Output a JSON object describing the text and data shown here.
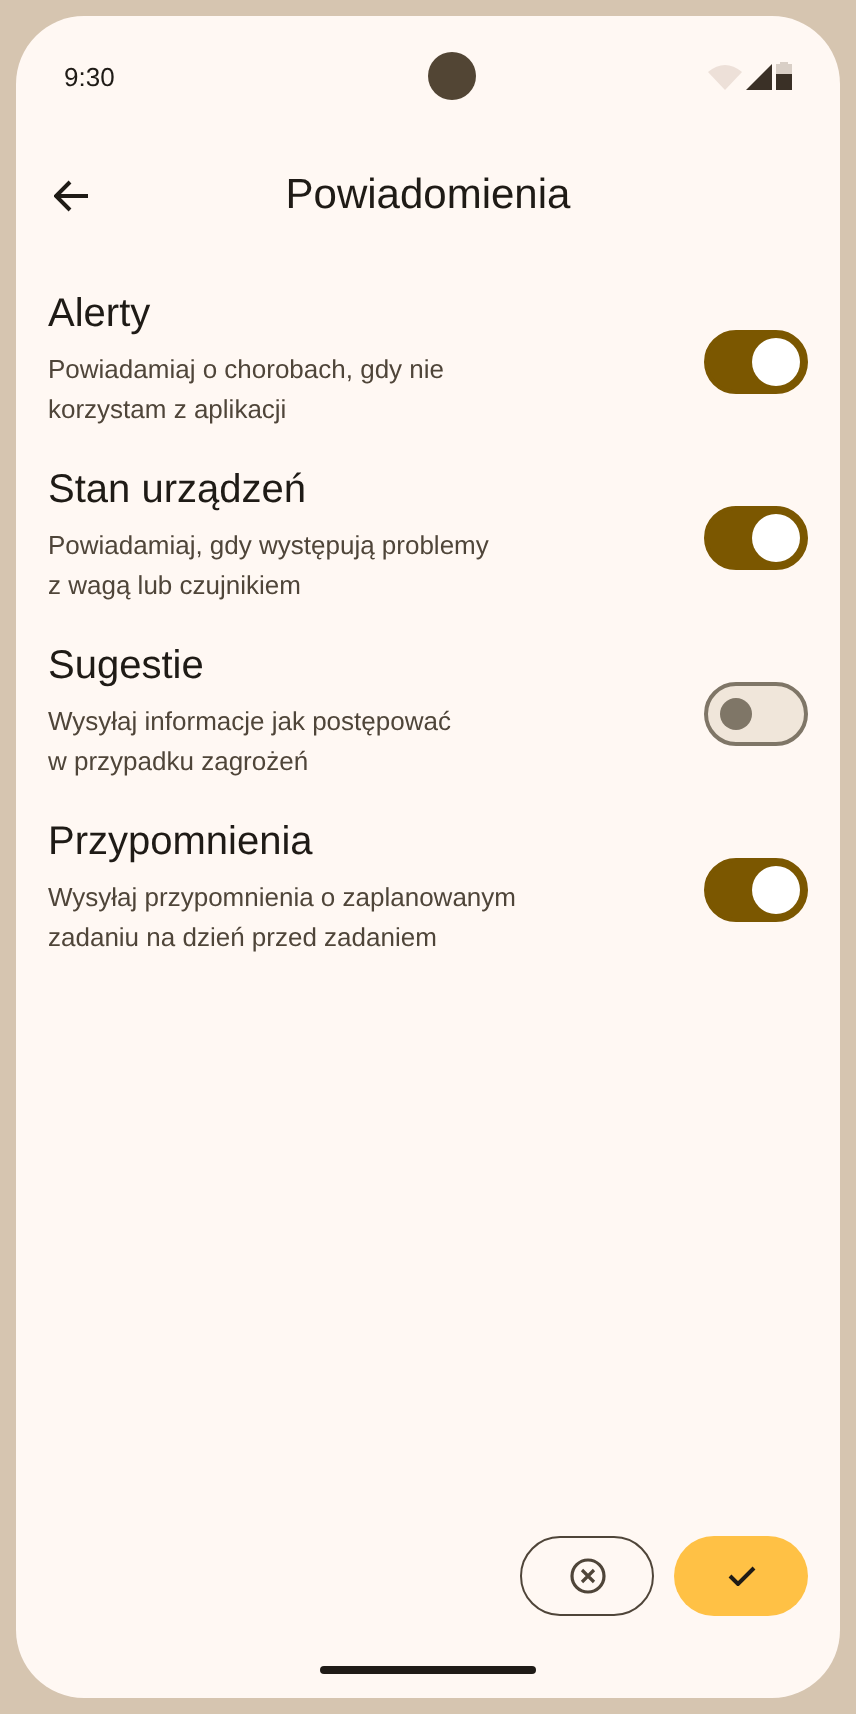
{
  "status_bar": {
    "time": "9:30"
  },
  "header": {
    "title": "Powiadomienia"
  },
  "settings": [
    {
      "title": "Alerty",
      "description": "Powiadamiaj o chorobach, gdy nie\nkorzystam z aplikacji",
      "on": true
    },
    {
      "title": "Stan urządzeń",
      "description": "Powiadamiaj, gdy występują problemy\nz wagą lub czujnikiem",
      "on": true
    },
    {
      "title": "Sugestie",
      "description": "Wysyłaj informacje jak postępować\nw przypadku zagrożeń",
      "on": false
    },
    {
      "title": "Przypomnienia",
      "description": "Wysyłaj przypomnienia o zaplanowanym\nzadaniu na dzień przed zadaniem",
      "on": true
    }
  ]
}
